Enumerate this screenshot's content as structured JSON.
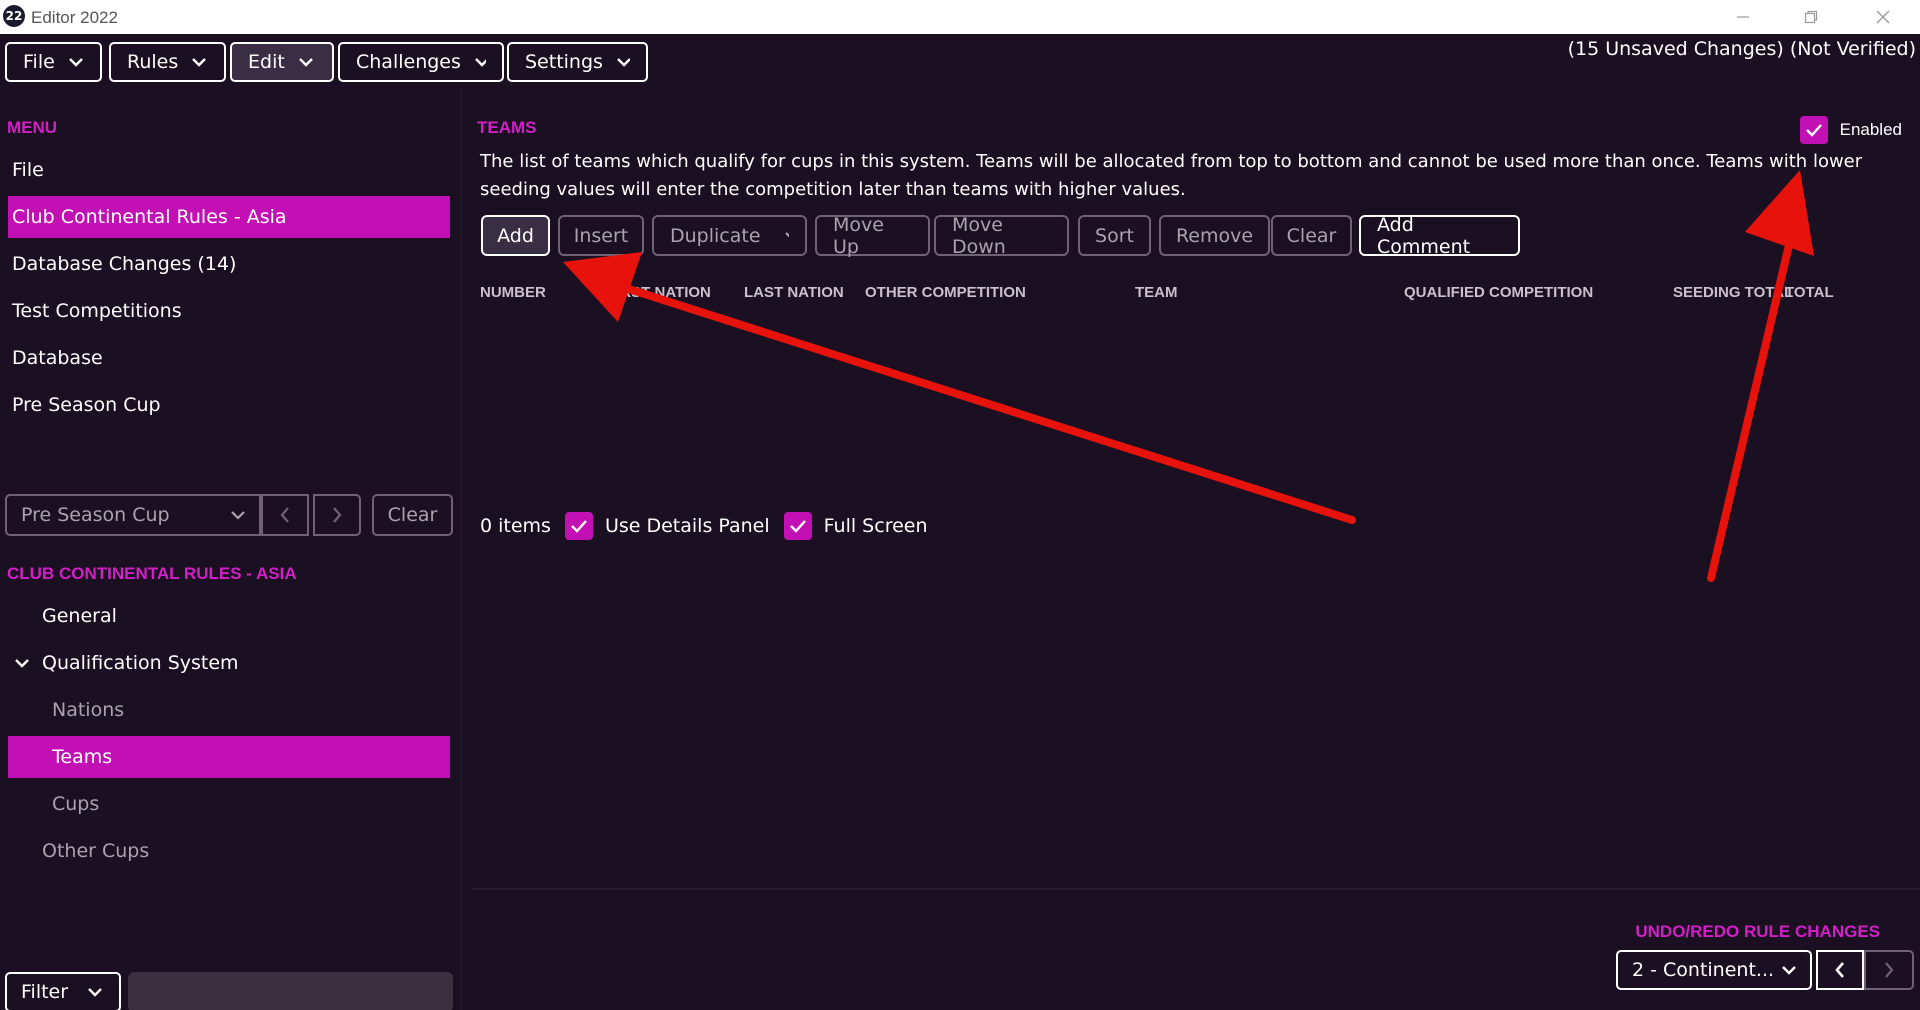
{
  "window": {
    "app_icon_text": "22",
    "title": "Editor 2022",
    "icons": [
      "minimize-icon",
      "restore-icon",
      "close-icon"
    ]
  },
  "topmenu": {
    "items": [
      {
        "label": "File"
      },
      {
        "label": "Rules"
      },
      {
        "label": "Edit"
      },
      {
        "label": "Challenges"
      },
      {
        "label": "Settings"
      }
    ],
    "status": "(15 Unsaved Changes) (Not Verified)"
  },
  "sidebar": {
    "menu_title": "MENU",
    "menu_items": [
      {
        "label": "File"
      },
      {
        "label": "Club Continental Rules - Asia"
      },
      {
        "label": "Database Changes (14)"
      },
      {
        "label": "Test Competitions"
      },
      {
        "label": "Database"
      },
      {
        "label": "Pre Season Cup"
      }
    ],
    "combo_value": "Pre Season Cup",
    "clear_label": "Clear",
    "section_title": "CLUB CONTINENTAL RULES - ASIA",
    "tree": [
      {
        "label": "General"
      },
      {
        "label": "Qualification System"
      },
      {
        "label": "Nations"
      },
      {
        "label": "Teams"
      },
      {
        "label": "Cups"
      },
      {
        "label": "Other Cups"
      }
    ],
    "filter_label": "Filter"
  },
  "main": {
    "title": "TEAMS",
    "enabled_label": "Enabled",
    "description": "The list of teams which qualify for cups in this system. Teams will be allocated from top to bottom and cannot be used more than once. Teams with lower seeding values will enter the competition later than teams with higher values.",
    "toolbar": {
      "add": "Add",
      "insert": "Insert",
      "duplicate": "Duplicate",
      "move_up": "Move Up",
      "move_down": "Move Down",
      "sort": "Sort",
      "remove": "Remove",
      "clear": "Clear",
      "add_comment": "Add Comment"
    },
    "columns": {
      "number": "NUMBER",
      "first_nation": "FIRST NATION",
      "last_nation": "LAST NATION",
      "other_competition": "OTHER COMPETITION",
      "team": "TEAM",
      "qualified_competition": "QUALIFIED COMPETITION",
      "seeding_total": "SEEDING TOTAL",
      "total": "TOTAL"
    },
    "items_count": "0 items",
    "use_details_panel": "Use Details Panel",
    "full_screen": "Full Screen"
  },
  "undo": {
    "title": "UNDO/REDO RULE CHANGES",
    "value": "2 - Continent..."
  },
  "colors": {
    "accent": "#c210b5",
    "heading": "#d21fc7",
    "background": "#1b0f22",
    "annotation_arrow": "#e8120c"
  }
}
